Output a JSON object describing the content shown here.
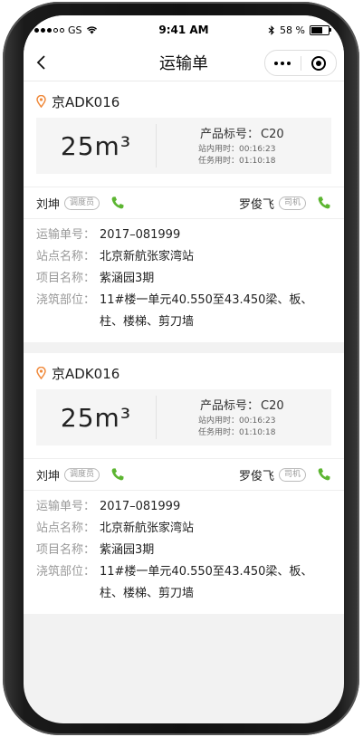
{
  "status_bar": {
    "carrier": "GS",
    "time": "9:41 AM",
    "battery_percent": "58 %"
  },
  "nav": {
    "title": "运输单"
  },
  "orders": [
    {
      "station": "京ADK016",
      "volume": "25m³",
      "product_label": "产品标号：",
      "product_grade": "C20",
      "station_time": "站内用时：00:16:23",
      "task_time": "任务用时：01:10:18",
      "dispatcher_name": "刘坤",
      "dispatcher_tag": "调度员",
      "driver_name": "罗俊飞",
      "driver_tag": "司机",
      "fields": [
        {
          "label": "运输单号：",
          "value": "2017–081999"
        },
        {
          "label": "站点名称：",
          "value": "北京新航张家湾站"
        },
        {
          "label": "项目名称：",
          "value": "紫涵园3期"
        },
        {
          "label": "浇筑部位：",
          "value": "11#楼一单元40.550至43.450梁、板、柱、楼梯、剪刀墙"
        }
      ]
    },
    {
      "station": "京ADK016",
      "volume": "25m³",
      "product_label": "产品标号：",
      "product_grade": "C20",
      "station_time": "站内用时：00:16:23",
      "task_time": "任务用时：01:10:18",
      "dispatcher_name": "刘坤",
      "dispatcher_tag": "调度员",
      "driver_name": "罗俊飞",
      "driver_tag": "司机",
      "fields": [
        {
          "label": "运输单号：",
          "value": "2017–081999"
        },
        {
          "label": "站点名称：",
          "value": "北京新航张家湾站"
        },
        {
          "label": "项目名称：",
          "value": "紫涵园3期"
        },
        {
          "label": "浇筑部位：",
          "value": "11#楼一单元40.550至43.450梁、板、柱、楼梯、剪刀墙"
        }
      ]
    }
  ],
  "colors": {
    "location_pin": "#f08a3c",
    "phone_icon": "#5cb531",
    "label_gray": "#999999"
  }
}
